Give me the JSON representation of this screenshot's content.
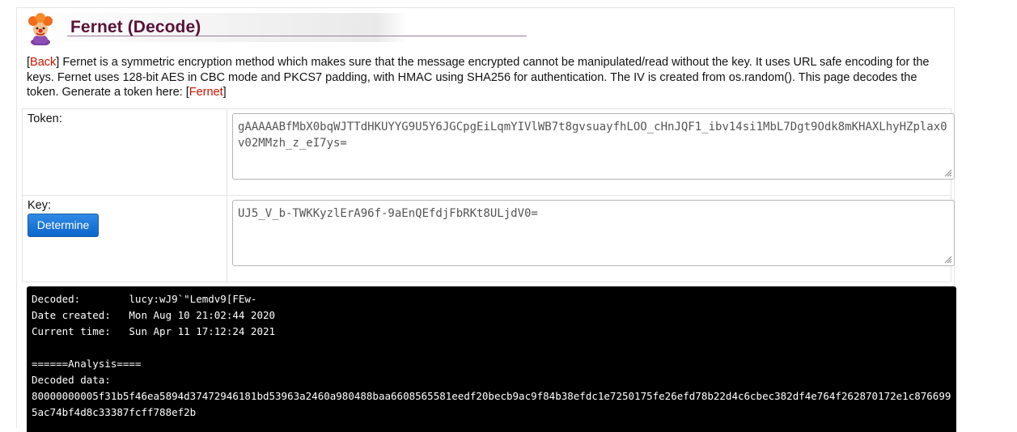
{
  "header": {
    "title": "Fernet (Decode)",
    "logo_icon": "clown-avatar-icon"
  },
  "intro": {
    "back_link": "Back",
    "description": "Fernet is a symmetric encryption method which makes sure that the message encrypted cannot be manipulated/read without the key. It uses URL safe encoding for the keys. Fernet uses 128-bit AES in CBC mode and PKCS7 padding, with HMAC using SHA256 for authentication. The IV is created from os.random(). This page decodes the token. Generate a token here: ",
    "fernet_link": "Fernet"
  },
  "form": {
    "token_label": "Token:",
    "token_value": "gAAAAABfMbX0bqWJTTdHKUYYG9U5Y6JGCpgEiLqmYIVlWB7t8gvsuayfhLOO_cHnJQF1_ibv14si1MbL7Dgt9Odk8mKHAXLhyHZplax0v02MMzh_z_eI7ys=",
    "key_label": "Key:",
    "key_value": "UJ5_V_b-TWKKyzlErA96f-9aEnQEfdjFbRKt8ULjdV0=",
    "determine_button": "Determine"
  },
  "output": {
    "decoded_line": "Decoded:        lucy:wJ9`\"Lemdv9[FEw-",
    "date_created_line": "Date created:   Mon Aug 10 21:02:44 2020",
    "current_time_line": "Current time:   Sun Apr 11 17:12:24 2021",
    "blank_line": "",
    "analysis_header": "======Analysis====",
    "decoded_data_label": "Decoded data:",
    "decoded_data_hex": "80000000005f31b5f46ea5894d37472946181bd53963a2460a980488baa6608565581eedf20becb9ac9f84b38efdc1e7250175fe26efd78b22d4c6cbec382df4e764f262870172e1c8766995ac74bf4d8c33387fcff788ef2b"
  },
  "colors": {
    "title": "#5a1238",
    "link": "#cc1100",
    "button": "#0c66cc",
    "terminal_bg": "#000000"
  }
}
